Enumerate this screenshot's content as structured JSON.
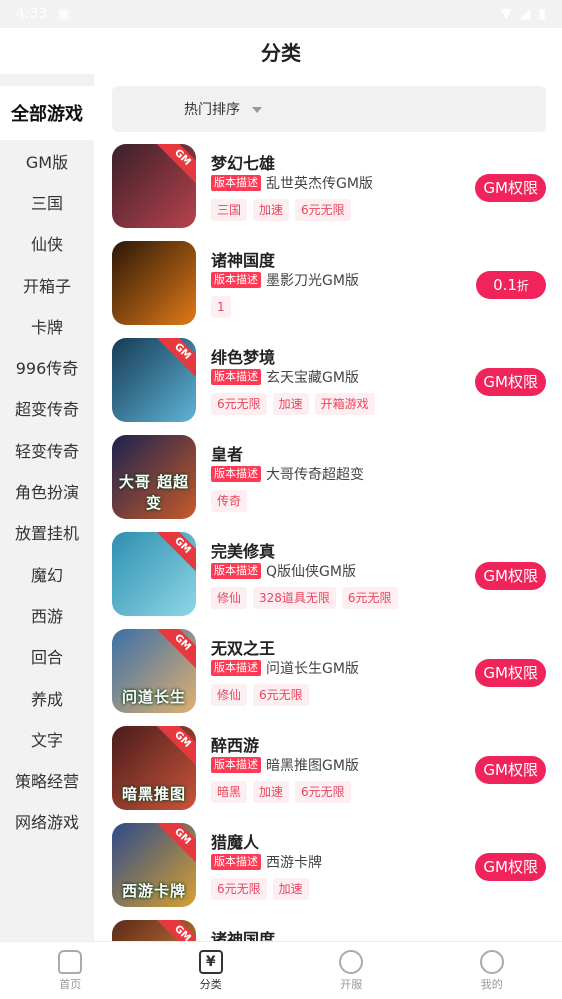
{
  "status": {
    "time": "4:33"
  },
  "header": {
    "title": "分类"
  },
  "sidebar": {
    "items": [
      {
        "label": "全部游戏",
        "active": true
      },
      {
        "label": "GM版"
      },
      {
        "label": "三国"
      },
      {
        "label": "仙侠"
      },
      {
        "label": "开箱子"
      },
      {
        "label": "卡牌"
      },
      {
        "label": "996传奇"
      },
      {
        "label": "超变传奇"
      },
      {
        "label": "轻变传奇"
      },
      {
        "label": "角色扮演"
      },
      {
        "label": "放置挂机"
      },
      {
        "label": "魔幻"
      },
      {
        "label": "西游"
      },
      {
        "label": "回合"
      },
      {
        "label": "养成"
      },
      {
        "label": "文字"
      },
      {
        "label": "策略经营"
      },
      {
        "label": "网络游戏"
      }
    ]
  },
  "sort": {
    "label": "热门排序"
  },
  "desc_badge": "版本描述",
  "games": [
    {
      "name": "梦幻七雄",
      "desc": "乱世英杰传GM版",
      "tags": [
        "三国",
        "加速",
        "6元无限"
      ],
      "pill": "GM权限",
      "colors": [
        "#3a1f2a",
        "#b8434b"
      ],
      "gm": true,
      "icon_text": ""
    },
    {
      "name": "诸神国度",
      "desc": "墨影刀光GM版",
      "tags": [
        "1"
      ],
      "pill": "0.1",
      "pill_unit": "折",
      "colors": [
        "#2b1708",
        "#e07a17"
      ],
      "gm": false,
      "icon_text": ""
    },
    {
      "name": "绯色梦境",
      "desc": "玄天宝藏GM版",
      "tags": [
        "6元无限",
        "加速",
        "开箱游戏"
      ],
      "pill": "GM权限",
      "colors": [
        "#163a55",
        "#5fb4d6"
      ],
      "gm": true,
      "icon_text": ""
    },
    {
      "name": "皇者",
      "desc": "大哥传奇超超变",
      "tags": [
        "传奇"
      ],
      "pill": "",
      "colors": [
        "#1b2350",
        "#c85a2a"
      ],
      "gm": false,
      "icon_text": "大哥 超超变"
    },
    {
      "name": "完美修真",
      "desc": "Q版仙侠GM版",
      "tags": [
        "修仙",
        "328道具无限",
        "6元无限"
      ],
      "pill": "GM权限",
      "colors": [
        "#2d8fb0",
        "#8fd6e6"
      ],
      "gm": true,
      "icon_text": ""
    },
    {
      "name": "无双之王",
      "desc": "问道长生GM版",
      "tags": [
        "修仙",
        "6元无限"
      ],
      "pill": "GM权限",
      "colors": [
        "#3a6fa8",
        "#e0b070"
      ],
      "gm": true,
      "icon_text": "问道长生"
    },
    {
      "name": "醉西游",
      "desc": "暗黑推图GM版",
      "tags": [
        "暗黑",
        "加速",
        "6元无限"
      ],
      "pill": "GM权限",
      "colors": [
        "#4a1c1c",
        "#c9553a"
      ],
      "gm": true,
      "icon_text": "暗黑推图"
    },
    {
      "name": "猎魔人",
      "desc": "西游卡牌",
      "tags": [
        "6元无限",
        "加速"
      ],
      "pill": "GM权限",
      "colors": [
        "#2c4a8a",
        "#d8a032"
      ],
      "gm": true,
      "icon_text": "西游卡牌"
    },
    {
      "name": "诸神国度",
      "desc": "",
      "tags": [],
      "pill": "",
      "colors": [
        "#5a2a1a",
        "#e58a3a"
      ],
      "gm": true,
      "icon_text": ""
    }
  ],
  "tabs": [
    {
      "label": "首页",
      "icon": "home-icon"
    },
    {
      "label": "分类",
      "icon": "category-icon",
      "active": true
    },
    {
      "label": "开服",
      "icon": "alarm-clock-icon"
    },
    {
      "label": "我的",
      "icon": "user-icon"
    }
  ]
}
